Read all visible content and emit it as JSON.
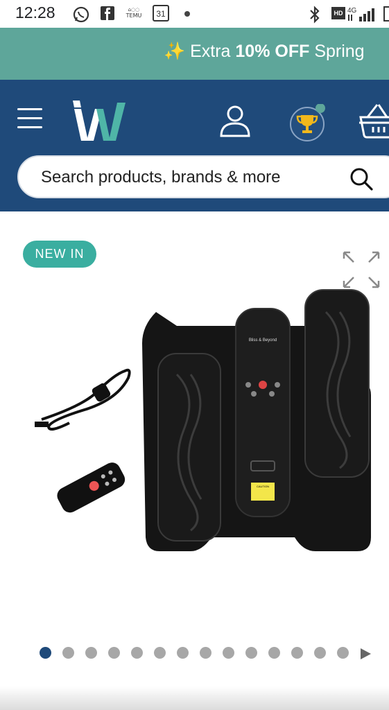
{
  "status_bar": {
    "time": "12:28",
    "icons": [
      "whatsapp-icon",
      "facebook-icon",
      "temu-icon",
      "calendar-icon",
      "dot-icon",
      "bluetooth-icon",
      "hd-icon",
      "signal-4g-icon",
      "battery-icon"
    ],
    "calendar_day": "31",
    "temu_label": "TEMU",
    "network": "4G",
    "hd_label": "HD"
  },
  "promo": {
    "emoji": "✨",
    "text_start": "Extra ",
    "text_bold": "10% OFF",
    "text_end": " Spring"
  },
  "header": {
    "logo_text": "W",
    "search_placeholder": "Search products, brands & more"
  },
  "product": {
    "badge": "NEW IN",
    "brand_text": "Bliss & Beyond",
    "caution_label": "CAUTION"
  },
  "carousel": {
    "total_dots": 14,
    "active_index": 0
  },
  "colors": {
    "promo_bg": "#5ea69a",
    "header_bg": "#1f4a7a",
    "badge_bg": "#3aaea0",
    "active_dot": "#1f4a7a"
  }
}
